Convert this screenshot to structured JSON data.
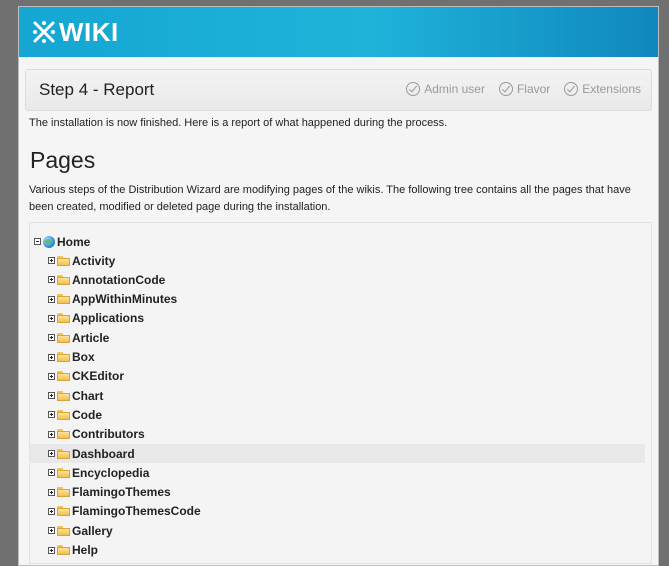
{
  "app": {
    "logo_text": "WIKI"
  },
  "step_bar": {
    "title": "Step 4 - Report",
    "steps": [
      {
        "label": "Admin user"
      },
      {
        "label": "Flavor"
      },
      {
        "label": "Extensions"
      }
    ]
  },
  "intro": "The installation is now finished. Here is a report of what happened during the process.",
  "pages": {
    "heading": "Pages",
    "description": "Various steps of the Distribution Wizard are modifying pages of the wikis. The following tree contains all the pages that have been created, modified or deleted page during the installation."
  },
  "tree": {
    "root": {
      "label": "Home",
      "expanded": true,
      "icon": "globe-icon"
    },
    "children": [
      {
        "label": "Activity"
      },
      {
        "label": "AnnotationCode"
      },
      {
        "label": "AppWithinMinutes"
      },
      {
        "label": "Applications"
      },
      {
        "label": "Article"
      },
      {
        "label": "Box"
      },
      {
        "label": "CKEditor"
      },
      {
        "label": "Chart"
      },
      {
        "label": "Code"
      },
      {
        "label": "Contributors"
      },
      {
        "label": "Dashboard",
        "highlighted": true
      },
      {
        "label": "Encyclopedia"
      },
      {
        "label": "FlamingoThemes"
      },
      {
        "label": "FlamingoThemesCode"
      },
      {
        "label": "Gallery"
      },
      {
        "label": "Help"
      }
    ]
  },
  "colors": {
    "header_start": "#15a6d1",
    "header_end": "#1087be",
    "folder": "#f0c04e"
  }
}
